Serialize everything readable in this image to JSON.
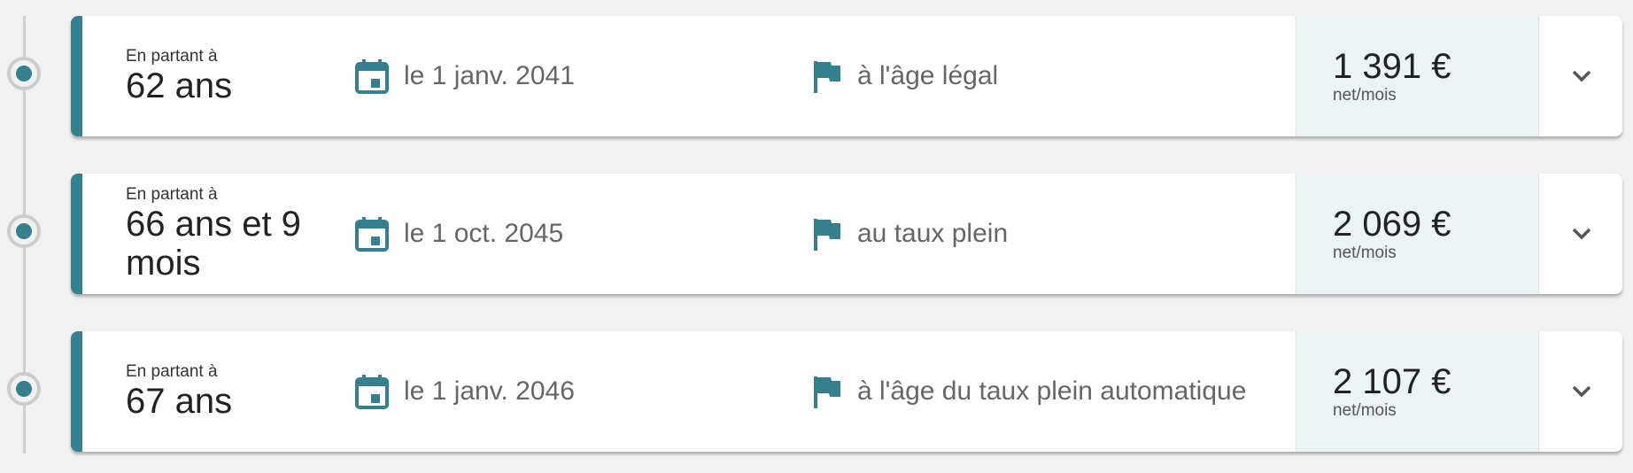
{
  "colors": {
    "accent": "#35808f",
    "amount_background": "#ecf3f5",
    "timeline": "#cccccc"
  },
  "icons": {
    "date": "calendar-icon",
    "condition": "flag-icon",
    "expand": "chevron-down-icon"
  },
  "options": [
    {
      "age_caption": "En partant à",
      "age": "62 ans",
      "date": "le 1 janv. 2041",
      "condition": "à l'âge légal",
      "amount": "1 391 €",
      "amount_unit": "net/mois"
    },
    {
      "age_caption": "En partant à",
      "age": "66 ans et 9 mois",
      "date": "le 1 oct. 2045",
      "condition": "au taux plein",
      "amount": "2 069 €",
      "amount_unit": "net/mois"
    },
    {
      "age_caption": "En partant à",
      "age": "67 ans",
      "date": "le 1 janv. 2046",
      "condition": "à l'âge du taux plein automatique",
      "amount": "2 107 €",
      "amount_unit": "net/mois"
    }
  ]
}
